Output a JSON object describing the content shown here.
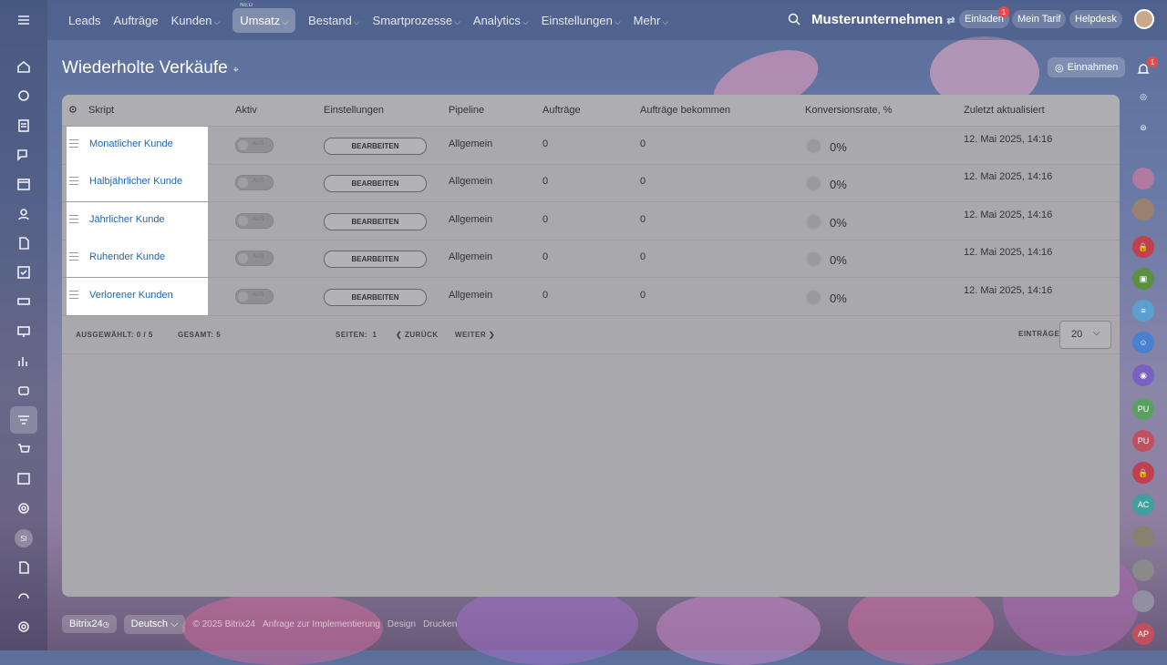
{
  "nav": {
    "items": [
      {
        "label": "Leads",
        "chev": false
      },
      {
        "label": "Aufträge",
        "chev": false
      },
      {
        "label": "Kunden",
        "chev": true
      },
      {
        "label": "Umsatz",
        "chev": true,
        "active": true,
        "badge": "NEU"
      },
      {
        "label": "Bestand",
        "chev": true
      },
      {
        "label": "Smartprozesse",
        "chev": true
      },
      {
        "label": "Analytics",
        "chev": true
      },
      {
        "label": "Einstellungen",
        "chev": true
      },
      {
        "label": "Mehr",
        "chev": true
      }
    ],
    "company": "Musterunternehmen",
    "invite": "Einladen",
    "invite_badge": "1",
    "tariff": "Mein Tarif",
    "helpdesk": "Helpdesk"
  },
  "page": {
    "title": "Wiederholte Verkäufe",
    "income_button": "Einnahmen"
  },
  "table": {
    "headers": {
      "skript": "Skript",
      "aktiv": "Aktiv",
      "einstellungen": "Einstellungen",
      "pipeline": "Pipeline",
      "auftraege": "Aufträge",
      "bekommen": "Aufträge bekommen",
      "konversion": "Konversionsrate, %",
      "zuletzt": "Zuletzt aktualisiert"
    },
    "rows": [
      {
        "name": "Monatlicher Kunde",
        "toggle": "AUS",
        "edit": "BEARBEITEN",
        "pipeline": "Allgemein",
        "orders": "0",
        "received": "0",
        "conv": "0%",
        "updated": "12. Mai 2025, 14:16"
      },
      {
        "name": "Halbjährlicher Kunde",
        "toggle": "AUS",
        "edit": "BEARBEITEN",
        "pipeline": "Allgemein",
        "orders": "0",
        "received": "0",
        "conv": "0%",
        "updated": "12. Mai 2025, 14:16"
      },
      {
        "name": "Jährlicher Kunde",
        "toggle": "AUS",
        "edit": "BEARBEITEN",
        "pipeline": "Allgemein",
        "orders": "0",
        "received": "0",
        "conv": "0%",
        "updated": "12. Mai 2025, 14:16"
      },
      {
        "name": "Ruhender Kunde",
        "toggle": "AUS",
        "edit": "BEARBEITEN",
        "pipeline": "Allgemein",
        "orders": "0",
        "received": "0",
        "conv": "0%",
        "updated": "12. Mai 2025, 14:16"
      },
      {
        "name": "Verlorener Kunden",
        "toggle": "AUS",
        "edit": "BEARBEITEN",
        "pipeline": "Allgemein",
        "orders": "0",
        "received": "0",
        "conv": "0%",
        "updated": "12. Mai 2025, 14:16"
      }
    ],
    "footer": {
      "selected_label": "AUSGEWÄHLT:",
      "selected_value": "0 / 5",
      "total_label": "GESAMT:",
      "total_value": "5",
      "pages_label": "SEITEN:",
      "pages_value": "1",
      "back": "ZURÜCK",
      "next": "WEITER",
      "entries_label": "EINTRÄGE",
      "entries_value": "20"
    }
  },
  "bottom": {
    "brand": "Bitrix24",
    "lang": "Deutsch",
    "copyright": "© 2025 Bitrix24",
    "impl": "Anfrage zur Implementierung",
    "design": "Design",
    "print": "Drucken"
  },
  "right_bar": {
    "notif_badge": "1",
    "avatars": [
      "PU",
      "PU",
      "AC",
      "AP"
    ]
  },
  "left_bar": {
    "avatar": "SI"
  }
}
